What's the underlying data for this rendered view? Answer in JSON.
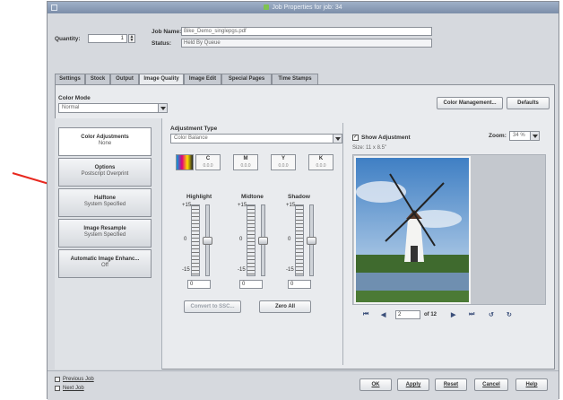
{
  "window": {
    "title": "Job Properties for job: 34"
  },
  "job": {
    "quantity_label": "Quantity:",
    "quantity_value": "1",
    "name_label": "Job Name:",
    "name_value": "Bike_Demo_singlepgs.pdf",
    "status_label": "Status:",
    "status_value": "Held By Queue"
  },
  "tabs": [
    {
      "label": "Settings"
    },
    {
      "label": "Stock"
    },
    {
      "label": "Output"
    },
    {
      "label": "Image Quality",
      "active": true
    },
    {
      "label": "Image Edit"
    },
    {
      "label": "Special Pages"
    },
    {
      "label": "Time Stamps"
    }
  ],
  "color_mode": {
    "label": "Color Mode",
    "value": "Normal"
  },
  "top_buttons": {
    "color_management": "Color Management...",
    "defaults": "Defaults"
  },
  "sidebar": [
    {
      "title": "Color Adjustments",
      "subtitle": "None",
      "active": true
    },
    {
      "title": "Options",
      "subtitle": "Postscript Overprint"
    },
    {
      "title": "Halftone",
      "subtitle": "System Specified"
    },
    {
      "title": "Image Resample",
      "subtitle": "System Specified"
    },
    {
      "title": "Automatic Image Enhanc...",
      "subtitle": "Off"
    }
  ],
  "adjustment": {
    "type_label": "Adjustment Type",
    "type_value": "Color Balance",
    "channels": [
      {
        "label": "C",
        "value": "0.0.0"
      },
      {
        "label": "M",
        "value": "0.0.0"
      },
      {
        "label": "Y",
        "value": "0.0.0"
      },
      {
        "label": "K",
        "value": "0.0.0"
      }
    ],
    "sliders": [
      {
        "label": "Highlight",
        "top": "+15",
        "mid": "0",
        "bottom": "-15",
        "value": "0"
      },
      {
        "label": "Midtone",
        "top": "+15",
        "mid": "0",
        "bottom": "-15",
        "value": "0"
      },
      {
        "label": "Shadow",
        "top": "+15",
        "mid": "0",
        "bottom": "-15",
        "value": "0"
      }
    ],
    "convert_button": "Convert to SSC...",
    "zero_all_button": "Zero All"
  },
  "preview": {
    "show_adjustment_label": "Show Adjustment",
    "size_text": "Size: 11 x 8.5\"",
    "zoom_label": "Zoom:",
    "zoom_value": "34 %",
    "page_value": "2",
    "page_total": "of 12"
  },
  "bottom": {
    "previous_job": "Previous Job",
    "next_job": "Next Job",
    "ok": "OK",
    "apply": "Apply",
    "reset": "Reset",
    "cancel": "Cancel",
    "help": "Help"
  },
  "colors": {
    "annotation_arrow": "#e8281f",
    "titlebar": "#7c8ea9",
    "panel": "#e9ebee"
  }
}
